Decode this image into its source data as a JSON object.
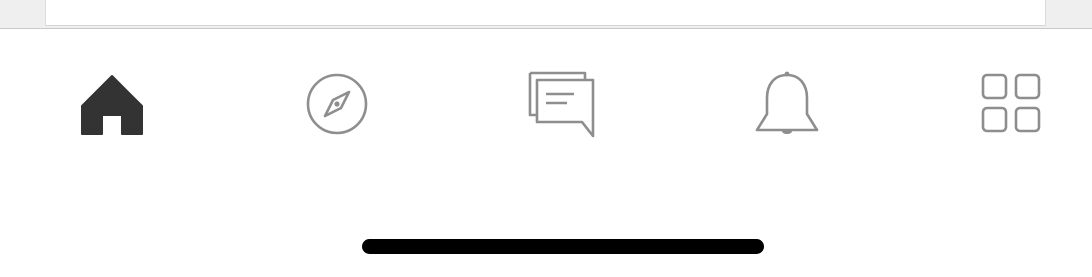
{
  "tab_bar": {
    "active_tab": "home",
    "tabs": [
      {
        "id": "home",
        "icon": "home-icon",
        "active": true
      },
      {
        "id": "discover",
        "icon": "compass-icon",
        "active": false
      },
      {
        "id": "messages",
        "icon": "chat-bubbles-icon",
        "active": false
      },
      {
        "id": "notifications",
        "icon": "bell-icon",
        "active": false
      },
      {
        "id": "more",
        "icon": "grid-icon",
        "active": false
      }
    ]
  },
  "colors": {
    "active_icon": "#333333",
    "inactive_icon": "#8e8e8e",
    "background": "#ffffff",
    "home_indicator": "#000000"
  }
}
